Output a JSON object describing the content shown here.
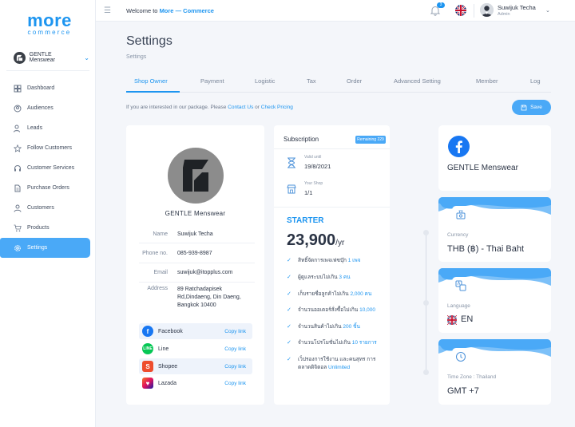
{
  "brand": {
    "logo_main": "more",
    "logo_sub": "commerce"
  },
  "store_selector": {
    "name": "GENTLE Menswear"
  },
  "sidebar": {
    "items": [
      {
        "label": "Dashboard",
        "icon": "dashboard-icon"
      },
      {
        "label": "Audiences",
        "icon": "audience-icon"
      },
      {
        "label": "Leads",
        "icon": "leads-icon"
      },
      {
        "label": "Follow Customers",
        "icon": "star-icon"
      },
      {
        "label": "Customer Services",
        "icon": "headset-icon"
      },
      {
        "label": "Purchase Orders",
        "icon": "document-icon"
      },
      {
        "label": "Customers",
        "icon": "user-icon"
      },
      {
        "label": "Products",
        "icon": "cart-icon"
      },
      {
        "label": "Settings",
        "icon": "gear-icon",
        "active": true
      }
    ]
  },
  "topbar": {
    "welcome_prefix": "Welcome to",
    "welcome_brand": "More — Commerce",
    "notification_count": "3",
    "user_name": "Suwijuk Techa",
    "user_role": "Admin"
  },
  "page": {
    "title": "Settings",
    "breadcrumb": "Settings"
  },
  "tabs": [
    "Shop Owner",
    "Payment",
    "Logistic",
    "Tax",
    "Order",
    "Advanced Setting",
    "Member",
    "Log"
  ],
  "info_bar": {
    "text_prefix": "If you are interested in our package. Please",
    "contact_link": "Contact Us",
    "or": "or",
    "pricing_link": "Check Pricing"
  },
  "save_label": "Save",
  "shop_owner": {
    "shop_name": "GENTLE Menswear",
    "fields": [
      {
        "key": "Name",
        "value": "Suwijuk Techa"
      },
      {
        "key": "Phone no.",
        "value": "085-939-8987"
      },
      {
        "key": "Email",
        "value": "suwijuk@itopplus.com"
      },
      {
        "key": "Address",
        "value_lines": [
          "89 Ratchadapisek",
          "Rd,Dindaeng, Din Daeng,",
          "Bangkok 10400"
        ]
      }
    ],
    "socials": [
      {
        "name": "Facebook",
        "action": "Copy link",
        "color": "#1877f2"
      },
      {
        "name": "Line",
        "action": "Copy link",
        "color": "#06c755"
      },
      {
        "name": "Shopee",
        "action": "Copy link",
        "color": "#ee4d2d"
      },
      {
        "name": "Lazada",
        "action": "Copy link",
        "color": "#1a1aa6"
      }
    ]
  },
  "subscription": {
    "title": "Subscription",
    "remaining": "Remaining 229 days",
    "valid_label": "Valid until",
    "valid_value": "19/8/2021",
    "shop_label": "Your Shop",
    "shop_value": "1/1",
    "plan": "STARTER",
    "price": "23,900",
    "price_unit": "/yr",
    "features": [
      {
        "text": "สิทธิ์จัดการเพจเฟซบุ๊ก",
        "highlight": "1 เพจ"
      },
      {
        "text": "ผู้ดูแลระบบไม่เกิน",
        "highlight": "3 คน"
      },
      {
        "text": "เก็บรายชื่อลูกค้าไม่เกิน",
        "highlight": "2,000 คน"
      },
      {
        "text": "จำนวนออเดอร์สั่งซื้อไม่เกิน",
        "highlight": "10,000"
      },
      {
        "text": "จำนวนสินค้าไม่เกิน",
        "highlight": "200 ชิ้น"
      },
      {
        "text": "จำนวนโปรโมชั่นไม่เกิน",
        "highlight": "10 รายการ"
      },
      {
        "text": "เว็ปรองการใช้งาน และคนสุทร การตลาดดิจิตอล",
        "highlight": "Unlimited"
      }
    ]
  },
  "right_cards": {
    "facebook_page": "GENTLE Menswear",
    "currency_label": "Currency",
    "currency_value": "THB (฿) - Thai Baht",
    "language_label": "Language",
    "language_value": "EN",
    "timezone_label": "Time Zone : Thailand",
    "timezone_value": "GMT +7"
  },
  "colors": {
    "accent": "#1d95f0",
    "accent_light": "#4aa9f7",
    "background": "#f4f6fa"
  }
}
